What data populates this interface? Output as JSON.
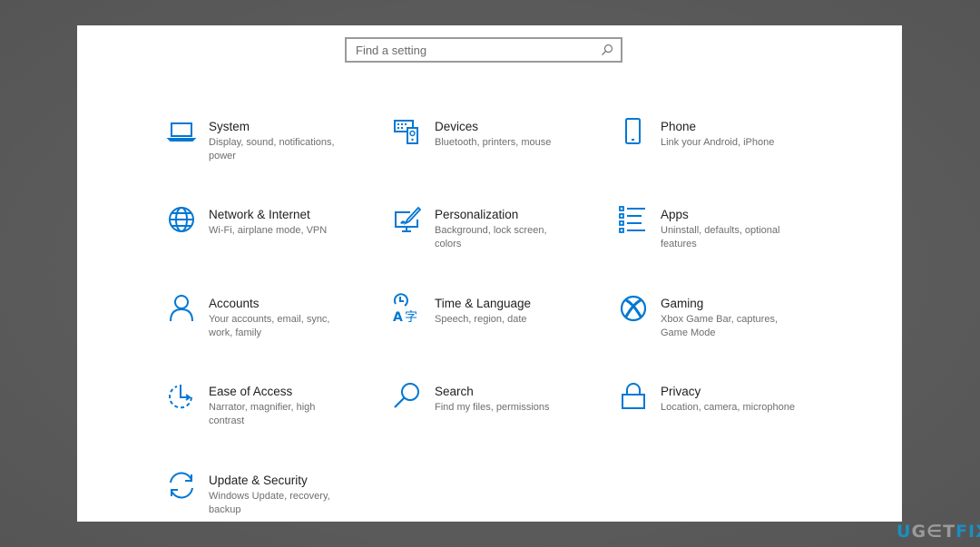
{
  "search": {
    "placeholder": "Find a setting",
    "value": "",
    "icon": "search-icon"
  },
  "accent_color": "#0078d4",
  "categories": [
    {
      "title": "System",
      "description": "Display, sound, notifications, power",
      "icon": "laptop-icon"
    },
    {
      "title": "Devices",
      "description": "Bluetooth, printers, mouse",
      "icon": "devices-icon"
    },
    {
      "title": "Phone",
      "description": "Link your Android, iPhone",
      "icon": "phone-icon"
    },
    {
      "title": "Network & Internet",
      "description": "Wi-Fi, airplane mode, VPN",
      "icon": "globe-icon"
    },
    {
      "title": "Personalization",
      "description": "Background, lock screen, colors",
      "icon": "paintbrush-icon"
    },
    {
      "title": "Apps",
      "description": "Uninstall, defaults, optional features",
      "icon": "apps-list-icon"
    },
    {
      "title": "Accounts",
      "description": "Your accounts, email, sync, work, family",
      "icon": "person-icon"
    },
    {
      "title": "Time & Language",
      "description": "Speech, region, date",
      "icon": "time-language-icon"
    },
    {
      "title": "Gaming",
      "description": "Xbox Game Bar, captures, Game Mode",
      "icon": "xbox-icon"
    },
    {
      "title": "Ease of Access",
      "description": "Narrator, magnifier, high contrast",
      "icon": "ease-of-access-icon"
    },
    {
      "title": "Search",
      "description": "Find my files, permissions",
      "icon": "magnifier-icon"
    },
    {
      "title": "Privacy",
      "description": "Location, camera, microphone",
      "icon": "lock-icon"
    },
    {
      "title": "Update & Security",
      "description": "Windows Update, recovery, backup",
      "icon": "sync-icon"
    }
  ],
  "watermark": {
    "parts": [
      "U",
      "G",
      "∈",
      "T",
      "FIX"
    ]
  }
}
